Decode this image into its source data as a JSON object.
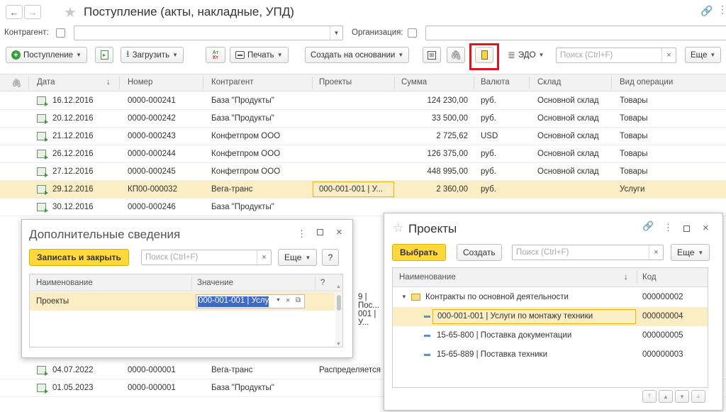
{
  "window": {
    "title": "Поступление (акты, накладные, УПД)"
  },
  "filters": {
    "kontragent_label": "Контрагент:",
    "organization_label": "Организация:"
  },
  "toolbar": {
    "create_label": "Поступление",
    "load_label": "Загрузить",
    "print_label": "Печать",
    "create_based_label": "Создать на основании",
    "edo_label": "ЭДО",
    "search_placeholder": "Поиск (Ctrl+F)",
    "more_label": "Еще",
    "clear_label": "×"
  },
  "table": {
    "columns": [
      "Дата",
      "Номер",
      "Контрагент",
      "Проекты",
      "Сумма",
      "Валюта",
      "Склад",
      "Вид операции"
    ],
    "sort_indicator": "↓",
    "rows": [
      {
        "date": "16.12.2016",
        "number": "0000-000241",
        "counterparty": "База \"Продукты\"",
        "project": "",
        "sum": "124 230,00",
        "currency": "руб.",
        "warehouse": "Основной склад",
        "operation": "Товары"
      },
      {
        "date": "20.12.2016",
        "number": "0000-000242",
        "counterparty": "База \"Продукты\"",
        "project": "",
        "sum": "33 500,00",
        "currency": "руб.",
        "warehouse": "Основной склад",
        "operation": "Товары"
      },
      {
        "date": "21.12.2016",
        "number": "0000-000243",
        "counterparty": "Конфетпром ООО",
        "project": "",
        "sum": "2 725,62",
        "currency": "USD",
        "warehouse": "Основной склад",
        "operation": "Товары"
      },
      {
        "date": "26.12.2016",
        "number": "0000-000244",
        "counterparty": "Конфетпром ООО",
        "project": "",
        "sum": "126 375,00",
        "currency": "руб.",
        "warehouse": "Основной склад",
        "operation": "Товары"
      },
      {
        "date": "27.12.2016",
        "number": "0000-000245",
        "counterparty": "Конфетпром ООО",
        "project": "",
        "sum": "448 995,00",
        "currency": "руб.",
        "warehouse": "Основной склад",
        "operation": "Товары"
      },
      {
        "date": "29.12.2016",
        "number": "КП00-000032",
        "counterparty": "Вега-транс",
        "project": "000-001-001 | У...",
        "sum": "2 360,00",
        "currency": "руб.",
        "warehouse": "",
        "operation": "Услуги"
      },
      {
        "date": "30.12.2016",
        "number": "0000-000246",
        "counterparty": "База \"Продукты\"",
        "project": "",
        "sum": "",
        "currency": "",
        "warehouse": "",
        "operation": ""
      }
    ],
    "bottom_rows": [
      {
        "date": "04.07.2022",
        "number": "0000-000001",
        "counterparty": "Вега-транс",
        "project": "Распределяется"
      },
      {
        "date": "01.05.2023",
        "number": "0000-000001",
        "counterparty": "База \"Продукты\"",
        "project": ""
      }
    ],
    "partial_project_1": "9 | Пос...",
    "partial_project_2": "001 | У..."
  },
  "dialog_dop": {
    "title": "Дополнительные сведения",
    "save_close_label": "Записать и закрыть",
    "search_placeholder": "Поиск (Ctrl+F)",
    "more_label": "Еще",
    "help_label": "?",
    "col_name": "Наименование",
    "col_value": "Значение",
    "col_q": "?",
    "row_name": "Проекты",
    "row_value": "000-001-001 | Услу"
  },
  "dialog_projects": {
    "title": "Проекты",
    "select_label": "Выбрать",
    "create_label": "Создать",
    "search_placeholder": "Поиск (Ctrl+F)",
    "more_label": "Еще",
    "col_name": "Наименование",
    "col_code": "Код",
    "sort_indicator": "↓",
    "rows": [
      {
        "name": "Контракты по основной деятельности",
        "code": "000000002",
        "type": "folder"
      },
      {
        "name": "000-001-001 | Услуги по монтажу техники",
        "code": "000000004",
        "type": "item"
      },
      {
        "name": "15-65-800 | Поставка документации",
        "code": "000000005",
        "type": "item"
      },
      {
        "name": "15-65-889 | Поставка техники",
        "code": "000000003",
        "type": "item"
      }
    ]
  },
  "colors": {
    "accent_yellow": "#ffd83b",
    "highlight_red": "#e0141e",
    "selected_row": "#fbeec4",
    "green_icon": "#3e9a3e"
  }
}
